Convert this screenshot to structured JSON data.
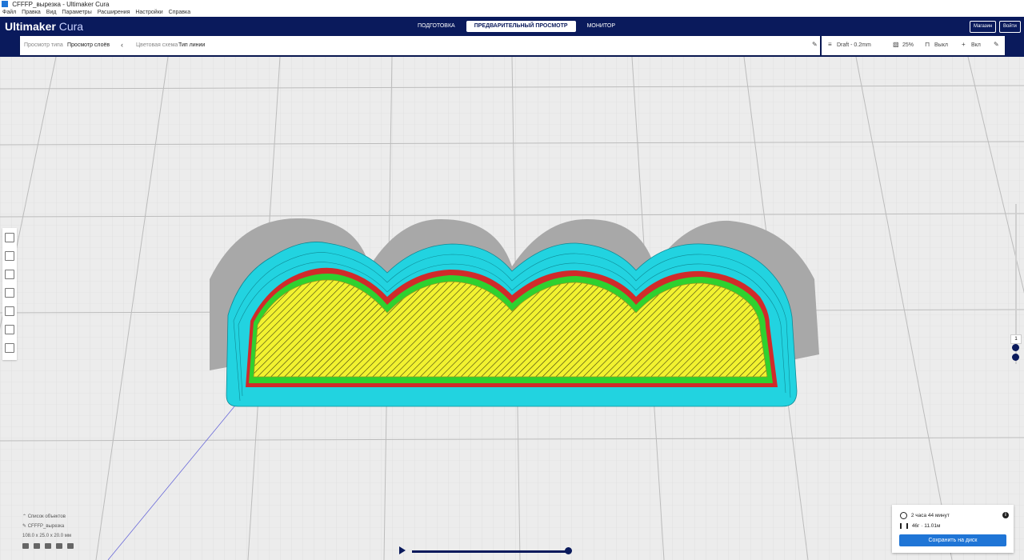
{
  "window": {
    "title": "CFFFP_вырезка - Ultimaker Cura"
  },
  "menu": [
    "Файл",
    "Правка",
    "Вид",
    "Параметры",
    "Расширения",
    "Настройки",
    "Справка"
  ],
  "header": {
    "brand": "Ultimaker",
    "brand_suffix": "Cura",
    "tabs": [
      "ПОДГОТОВКА",
      "ПРЕДВАРИТЕЛЬНЫЙ ПРОСМОТР",
      "МОНИТОР"
    ],
    "active_tab": 1,
    "buttons": [
      "Магазин",
      "Войти"
    ]
  },
  "toolbar": {
    "view_type_label": "Просмотр типа",
    "view_type_value": "Просмотр слоёв",
    "color_scheme_label": "Цветовая схема",
    "color_scheme_value": "Тип линии"
  },
  "print_settings": {
    "profile": "Draft - 0.2mm",
    "infill": "25%",
    "support": "Выкл",
    "adhesion": "Вкл"
  },
  "layer_slider": {
    "current_layer": "1"
  },
  "objects": {
    "header": "Список объектов",
    "item": "CFFFP_вырезка",
    "dimensions": "108.0 x 25.0 x 20.0 мм"
  },
  "print_info": {
    "time": "2 часа 44 минут",
    "material": "46г · 11.01м",
    "save_button": "Сохранить на диск"
  },
  "colors": {
    "header_bg": "#0a1a5c",
    "accent": "#1f75d6",
    "skirt": "#22d3e0",
    "wall_outer": "#d12a2a",
    "wall_inner": "#2fd12f",
    "infill": "#f2f230",
    "shadow": "#a8a8a8"
  }
}
